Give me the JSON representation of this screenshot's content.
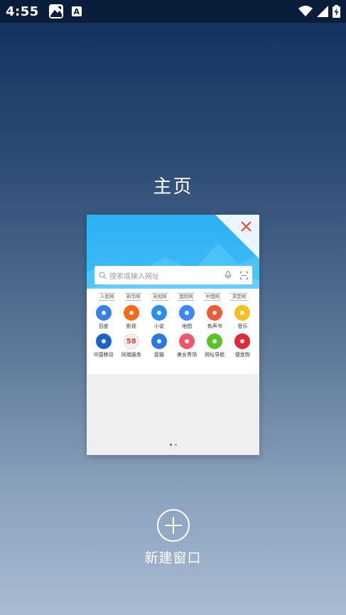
{
  "status_bar": {
    "time": "4:55",
    "a_icon_letter": "A"
  },
  "tab": {
    "title": "主页",
    "search_placeholder": "搜索或输入网址",
    "sites": [
      "人民网",
      "新华网",
      "央视网",
      "国际网",
      "中国网",
      "求是网"
    ],
    "apps": [
      {
        "label": "百度",
        "icon": "baidu-icon",
        "color": "#3b7de9"
      },
      {
        "label": "影视",
        "icon": "video-icon",
        "color": "#f46a1b"
      },
      {
        "label": "小说",
        "icon": "book-icon",
        "color": "#2a8ef0"
      },
      {
        "label": "地图",
        "icon": "map-icon",
        "color": "#3f87f5"
      },
      {
        "label": "有声书",
        "icon": "audio-book-icon",
        "color": "#ee5a36"
      },
      {
        "label": "音乐",
        "icon": "music-icon",
        "color": "#f5c01b"
      },
      {
        "label": "中国移动",
        "icon": "china-mobile-icon",
        "color": "#1b64c3"
      },
      {
        "label": "同城服务",
        "icon": "58-icon",
        "color": "#f0f0f0",
        "text": "58"
      },
      {
        "label": "捉猫",
        "icon": "cat-icon",
        "color": "#2a78e4"
      },
      {
        "label": "美女秀场",
        "icon": "live-show-icon",
        "color": "#f0566a"
      },
      {
        "label": "网址导航",
        "icon": "navigation-icon",
        "color": "#5cc12b"
      },
      {
        "label": "便宜购",
        "icon": "shopping-icon",
        "color": "#e0283a"
      }
    ]
  },
  "new_window": {
    "label": "新建窗口"
  }
}
